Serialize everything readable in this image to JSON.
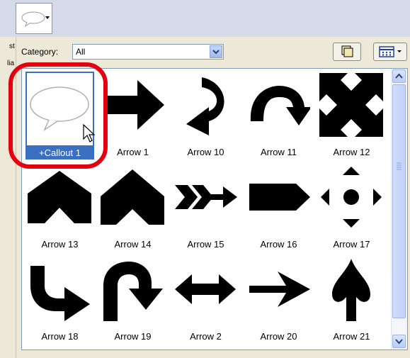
{
  "top_strip": {
    "dropdown_icon": "callout-thumbnail-icon"
  },
  "left_sliver": {
    "text_top": "st",
    "text_bottom": "lia"
  },
  "category": {
    "label": "Category:",
    "value": "All"
  },
  "toolbar": {
    "copy_icon": "copy-pages-icon",
    "view_icon": "view-grid-icon"
  },
  "shapes": [
    {
      "label": "+Callout 1",
      "icon": "callout-icon",
      "selected": true
    },
    {
      "label": "Arrow 1",
      "icon": "arrow-right-icon"
    },
    {
      "label": "Arrow 10",
      "icon": "curved-arrow-down-left-icon"
    },
    {
      "label": "Arrow 11",
      "icon": "u-turn-arrow-icon"
    },
    {
      "label": "Arrow 12",
      "icon": "four-way-arrow-icon"
    },
    {
      "label": "Arrow 13",
      "icon": "chevron-notch-up-icon"
    },
    {
      "label": "Arrow 14",
      "icon": "chevron-notch-up-2-icon"
    },
    {
      "label": "Arrow 15",
      "icon": "feathered-arrow-icon"
    },
    {
      "label": "Arrow 16",
      "icon": "pentagon-arrow-icon"
    },
    {
      "label": "Arrow 17",
      "icon": "four-triangles-dot-icon"
    },
    {
      "label": "Arrow 18",
      "icon": "bent-arrow-down-right-icon"
    },
    {
      "label": "Arrow 19",
      "icon": "u-turn-up-right-icon"
    },
    {
      "label": "Arrow 2",
      "icon": "double-arrow-horizontal-icon"
    },
    {
      "label": "Arrow 20",
      "icon": "thin-arrow-right-icon"
    },
    {
      "label": "Arrow 21",
      "icon": "arrow-up-flared-icon"
    }
  ],
  "colors": {
    "selection": "#3a6fc2",
    "highlight_ring": "#e3000f",
    "panel": "#ece9d8"
  }
}
